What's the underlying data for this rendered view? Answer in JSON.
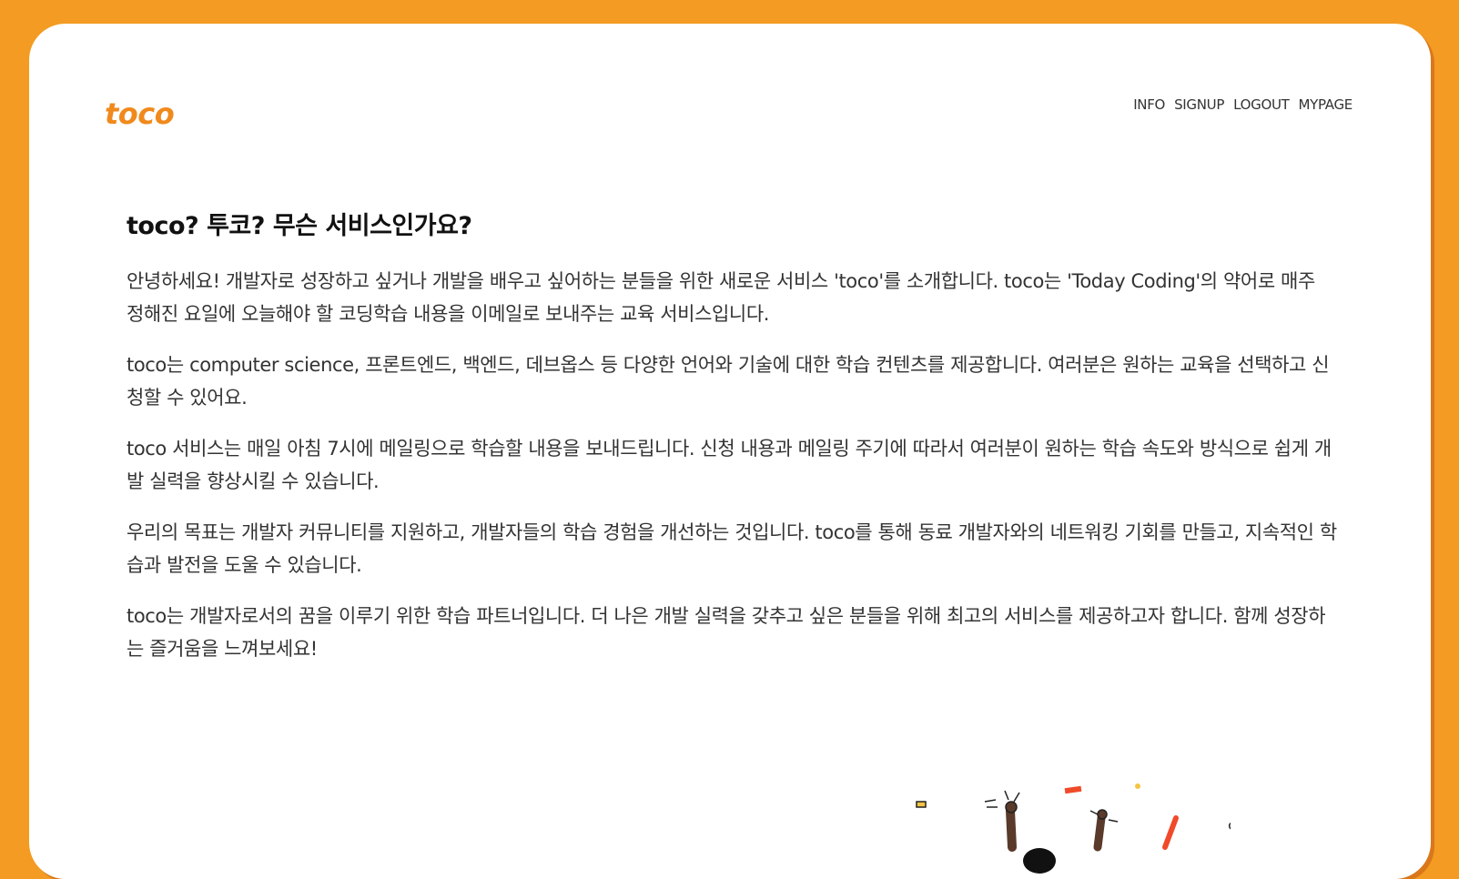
{
  "header": {
    "logo": "toco",
    "nav": {
      "info": "INFO",
      "signup": "SIGNUP",
      "logout": "LOGOUT",
      "mypage": "MYPAGE"
    }
  },
  "main": {
    "title": "toco? 투코? 무슨 서비스인가요?",
    "paragraphs": [
      "안녕하세요! 개발자로 성장하고 싶거나 개발을 배우고 싶어하는 분들을 위한 새로운 서비스 'toco'를 소개합니다. toco는 'Today Coding'의 약어로 매주 정해진 요일에 오늘해야 할 코딩학습 내용을 이메일로 보내주는 교육 서비스입니다.",
      "toco는 computer science, 프론트엔드, 백엔드, 데브옵스 등 다양한 언어와 기술에 대한 학습 컨텐츠를 제공합니다. 여러분은 원하는 교육을 선택하고 신청할 수 있어요.",
      "toco 서비스는 매일 아침 7시에 메일링으로 학습할 내용을 보내드립니다. 신청 내용과 메일링 주기에 따라서 여러분이 원하는 학습 속도와 방식으로 쉽게 개발 실력을 향상시킬 수 있습니다.",
      "우리의 목표는 개발자 커뮤니티를 지원하고, 개발자들의 학습 경험을 개선하는 것입니다. toco를 통해 동료 개발자와의 네트워킹 기회를 만들고, 지속적인 학습과 발전을 도울 수 있습니다.",
      "toco는 개발자로서의 꿈을 이루기 위한 학습 파트너입니다. 더 나은 개발 실력을 갖추고 싶은 분들을 위해 최고의 서비스를 제공하고자 합니다. 함께 성장하는 즐거움을 느껴보세요!"
    ]
  },
  "colors": {
    "background": "#F39B22",
    "card": "#FFFFFF",
    "logo": "#F08A1C",
    "text": "#333333"
  },
  "illustration": {
    "icon": "celebration-illustration"
  }
}
